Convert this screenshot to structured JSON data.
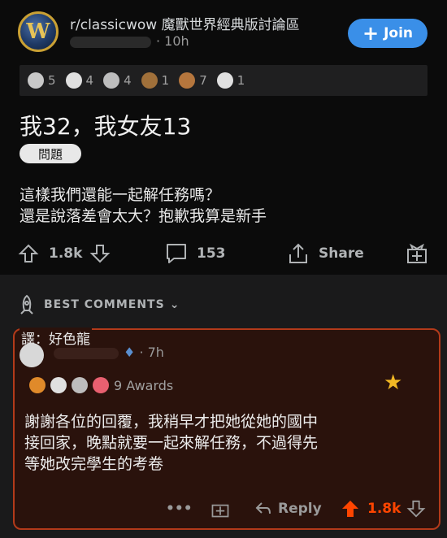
{
  "post": {
    "subreddit": "r/classicwow 魔獸世界經典版討論區",
    "age": "· 10h",
    "join_label": "Join",
    "awards": [
      {
        "icon": "helpful-award-icon",
        "count": "5",
        "color": "#c8c8c8"
      },
      {
        "icon": "wholesome-award-icon",
        "count": "4",
        "color": "#e0e0e0"
      },
      {
        "icon": "silver-award-icon",
        "count": "4",
        "color": "#bdbdbd"
      },
      {
        "icon": "bear-award-icon",
        "count": "1",
        "color": "#a0703a"
      },
      {
        "icon": "bear-face-award-icon",
        "count": "7",
        "color": "#b5763d"
      },
      {
        "icon": "snoo-award-icon",
        "count": "1",
        "color": "#e0e0e0"
      }
    ],
    "title": "我32，我女友13",
    "flair": "問題",
    "body": "這樣我們還能一起解任務嗎？\n還是說落差會太大？抱歉我算是新手",
    "upvotes": "1.8k",
    "comments": "153",
    "share_label": "Share"
  },
  "section": {
    "best_label": "BEST COMMENTS"
  },
  "comment": {
    "translation_tag": "譯：好色龍",
    "age": "· 7h",
    "awards_label": "9 Awards",
    "body": "謝謝各位的回覆，我稍早才把她從她的國中\n接回家，晚點就要一起來解任務，不過得先\n等她改完學生的考卷",
    "reply_label": "Reply",
    "upvotes": "1.8k",
    "more_label": "•••"
  },
  "colors": {
    "accent": "#3a8fe8",
    "upvote": "#ff4500",
    "highlight_border": "#b33a1a"
  }
}
